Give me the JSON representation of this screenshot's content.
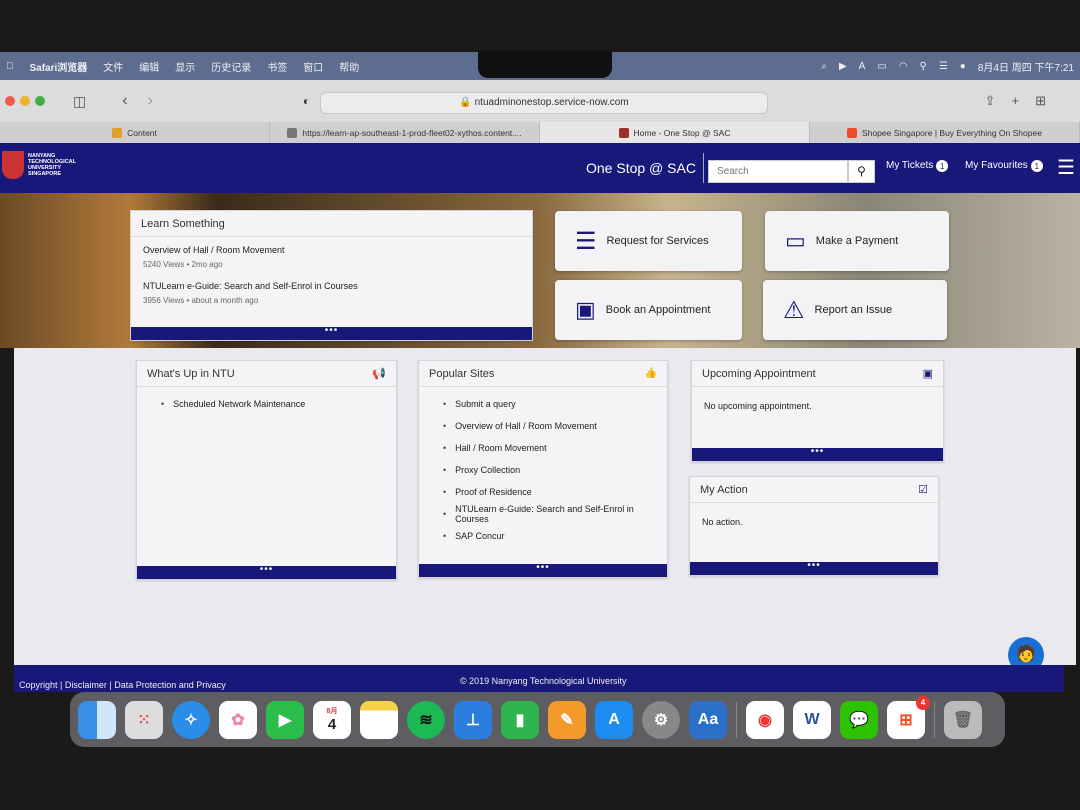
{
  "menubar": {
    "apple": "",
    "app": "Safari浏览器",
    "items": [
      "文件",
      "编辑",
      "显示",
      "历史记录",
      "书签",
      "窗口",
      "帮助"
    ],
    "clock": "8月4日 周四 下午7:21"
  },
  "browser": {
    "url": "ntuadminonestop.service-now.com",
    "tabs": [
      {
        "label": "Content",
        "color": "#e0a030"
      },
      {
        "label": "https://learn-ap-southeast-1-prod-fleet02-xythos.content....",
        "color": "#777"
      },
      {
        "label": "Home - One Stop @ SAC",
        "color": "#a03030"
      },
      {
        "label": "Shopee Singapore | Buy Everything On Shopee",
        "color": "#ee4d2d"
      }
    ]
  },
  "header": {
    "logo": [
      "NANYANG",
      "TECHNOLOGICAL",
      "UNIVERSITY",
      "SINGAPORE"
    ],
    "title": "One Stop @ SAC",
    "search_placeholder": "Search",
    "my_tickets": "My Tickets",
    "tickets_count": "1",
    "my_favourites": "My Favourites",
    "favourites_count": "1"
  },
  "learn": {
    "title": "Learn Something",
    "items": [
      {
        "title": "Overview of Hall / Room Movement",
        "views": "5240 Views",
        "age": "2mo ago"
      },
      {
        "title": "NTULearn e-Guide: Search and Self-Enrol in Courses",
        "views": "3956 Views",
        "age": "about a month ago"
      }
    ],
    "more": "•••"
  },
  "tiles": [
    {
      "label": "Request for Services",
      "icon": "list-icon"
    },
    {
      "label": "Make a Payment",
      "icon": "credit-card-icon"
    },
    {
      "label": "Book an Appointment",
      "icon": "address-book-icon"
    },
    {
      "label": "Report an Issue",
      "icon": "warning-icon"
    }
  ],
  "whats_up": {
    "title": "What's Up in NTU",
    "items": [
      "Scheduled Network Maintenance"
    ]
  },
  "popular": {
    "title": "Popular Sites",
    "items": [
      "Submit a query",
      "Overview of Hall / Room Movement",
      "Hall / Room Movement",
      "Proxy Collection",
      "Proof of Residence",
      "NTULearn e-Guide: Search and Self-Enrol in Courses",
      "SAP Concur"
    ]
  },
  "appointment": {
    "title": "Upcoming Appointment",
    "empty": "No upcoming appointment."
  },
  "action": {
    "title": "My Action",
    "empty": "No action."
  },
  "footer": {
    "links": "Copyright | Disclaimer | Data Protection and Privacy",
    "copyright": "© 2019 Nanyang Technological University"
  },
  "dock": {
    "calendar_month": "8月",
    "calendar_day": "4",
    "microsoft_badge": "4"
  },
  "colors": {
    "brand_navy": "#18187a"
  }
}
